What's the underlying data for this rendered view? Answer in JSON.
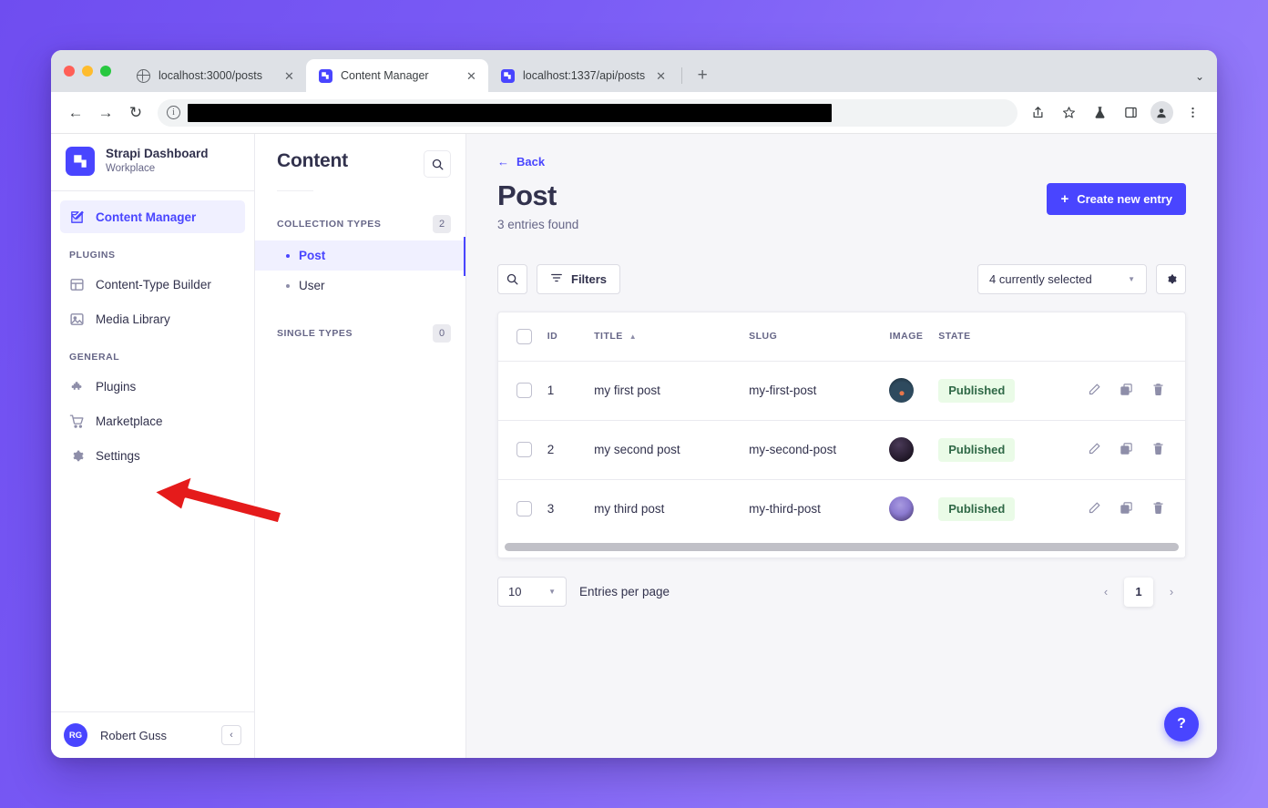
{
  "browser": {
    "tabs": [
      {
        "title": "localhost:3000/posts",
        "favicon": "globe-icon",
        "active": false
      },
      {
        "title": "Content Manager",
        "favicon": "strapi-icon",
        "active": true
      },
      {
        "title": "localhost:1337/api/posts",
        "favicon": "strapi-icon",
        "active": false
      }
    ],
    "new_tab_label": "+",
    "tab_list_chevron": "⌄",
    "back_label": "←",
    "forward_label": "→",
    "reload_label": "↻",
    "site_info_label": "i",
    "url_value": "",
    "url_placeholder": "",
    "toolbar_icons": [
      "share-icon",
      "bookmark-star-icon",
      "labs-flask-icon",
      "side-panel-icon",
      "profile-avatar-icon",
      "kebab-menu-icon"
    ]
  },
  "sidebar": {
    "brand": {
      "name": "Strapi Dashboard",
      "subtitle": "Workplace"
    },
    "primary": [
      {
        "label": "Content Manager",
        "icon": "pen-square-icon",
        "active": true
      }
    ],
    "sections": [
      {
        "label": "PLUGINS",
        "items": [
          {
            "label": "Content-Type Builder",
            "icon": "layout-icon"
          },
          {
            "label": "Media Library",
            "icon": "image-icon"
          }
        ]
      },
      {
        "label": "GENERAL",
        "items": [
          {
            "label": "Plugins",
            "icon": "puzzle-icon"
          },
          {
            "label": "Marketplace",
            "icon": "shopping-cart-icon"
          },
          {
            "label": "Settings",
            "icon": "gear-icon"
          }
        ]
      }
    ],
    "footer": {
      "initials": "RG",
      "name": "Robert Guss",
      "collapse_label": "‹"
    }
  },
  "content_panel": {
    "title": "Content",
    "search_icon": "search-icon",
    "groups": [
      {
        "label": "COLLECTION TYPES",
        "count": "2",
        "items": [
          {
            "label": "Post",
            "active": true
          },
          {
            "label": "User",
            "active": false
          }
        ]
      },
      {
        "label": "SINGLE TYPES",
        "count": "0",
        "items": []
      }
    ]
  },
  "main": {
    "back_label": "Back",
    "title": "Post",
    "subtitle": "3 entries found",
    "create_button": "Create new entry",
    "create_button_icon": "plus-icon",
    "toolbar": {
      "search_icon": "search-icon",
      "filters_label": "Filters",
      "filters_icon": "filter-icon",
      "field_select_value": "4 currently selected",
      "settings_icon": "gear-icon"
    },
    "table": {
      "columns": [
        "ID",
        "TITLE",
        "SLUG",
        "IMAGE",
        "STATE"
      ],
      "sorted_column": "TITLE",
      "sort_direction": "asc",
      "rows": [
        {
          "id": "1",
          "title": "my first post",
          "slug": "my-first-post",
          "image": "thumbnail-moon-orange",
          "state": "Published"
        },
        {
          "id": "2",
          "title": "my second post",
          "slug": "my-second-post",
          "image": "thumbnail-dark-purple",
          "state": "Published"
        },
        {
          "id": "3",
          "title": "my third post",
          "slug": "my-third-post",
          "image": "thumbnail-starry-sky",
          "state": "Published"
        }
      ],
      "row_action_icons": [
        "pencil-edit-icon",
        "duplicate-icon",
        "trash-delete-icon"
      ]
    },
    "pagination": {
      "page_size": "10",
      "page_size_label": "Entries per page",
      "prev_label": "‹",
      "next_label": "›",
      "current_page": "1"
    },
    "help_label": "?"
  },
  "annotation": {
    "type": "red-arrow",
    "points_to": "Settings",
    "color": "#e51b1b"
  },
  "colors": {
    "accent": "#4945ff",
    "accent_soft": "#f0f0ff",
    "text": "#32324d",
    "muted": "#666687",
    "published_bg": "#eafbe7",
    "published_text": "#2f6846",
    "desktop_gradient_from": "#6f4df0",
    "desktop_gradient_to": "#9a83fb"
  }
}
